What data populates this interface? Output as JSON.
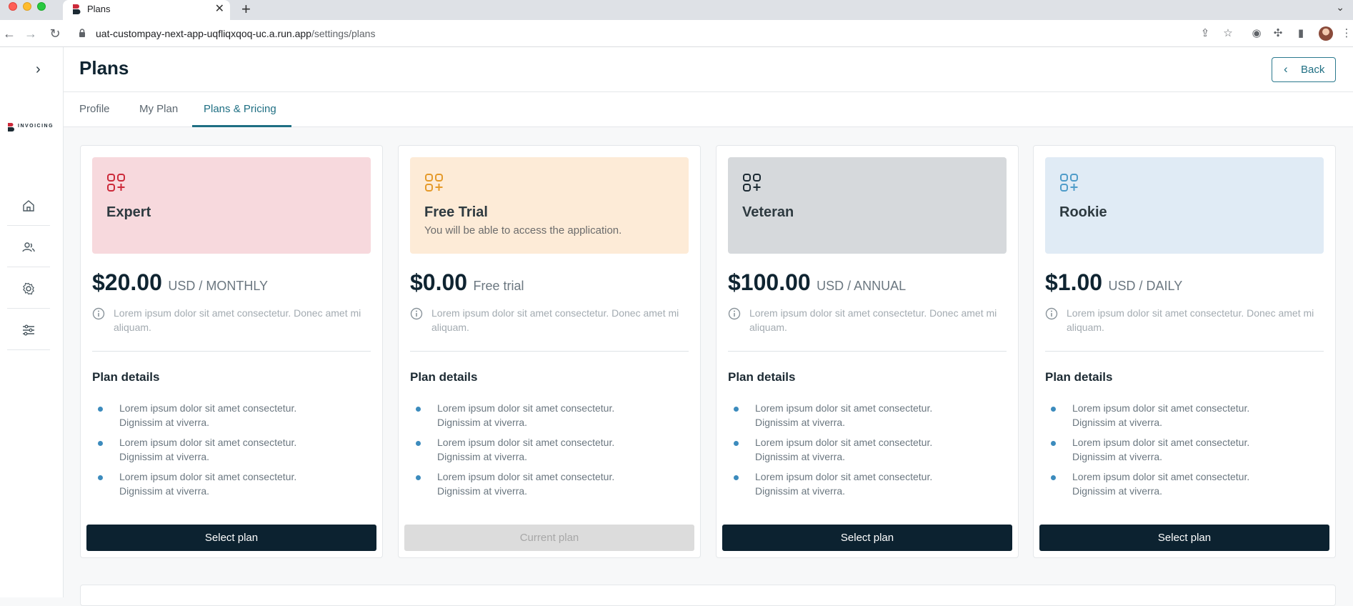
{
  "browser": {
    "tab_title": "Plans",
    "new_tab": "+",
    "close": "✕",
    "tab_menu": "⌄",
    "url_host": "uat-custompay-next-app-uqfliqxqoq-uc.a.run.app",
    "url_path": "/settings/plans"
  },
  "sidebar": {
    "toggle": "›",
    "logo_text": "INVOICING",
    "items": [
      "home-icon",
      "users-icon",
      "gear-icon",
      "sliders-icon"
    ]
  },
  "header": {
    "title": "Plans",
    "back_label": "Back",
    "back_chevron": "‹"
  },
  "tabs": [
    {
      "label": "Profile"
    },
    {
      "label": "My Plan"
    },
    {
      "label": "Plans & Pricing",
      "active": true
    }
  ],
  "plans": [
    {
      "name": "Expert",
      "desc": "",
      "price": "$20.00",
      "period": "USD / MONTHLY",
      "accent": "#cc2a3a",
      "bg": "#f7d9dd",
      "info": "Lorem ipsum dolor sit amet consectetur. Donec amet mi aliquam.",
      "details_title": "Plan details",
      "bullets": [
        "Lorem ipsum dolor sit amet consectetur. Dignissim at viverra.",
        "Lorem ipsum dolor sit amet consectetur. Dignissim at viverra.",
        "Lorem ipsum dolor sit amet consectetur. Dignissim at viverra."
      ],
      "cta": "Select plan",
      "cta_disabled": false
    },
    {
      "name": "Free Trial",
      "desc": "You will be able to access the application.",
      "price": "$0.00",
      "period": "Free trial",
      "accent": "#e59a2a",
      "bg": "#fdebd7",
      "info": "Lorem ipsum dolor sit amet consectetur. Donec amet mi aliquam.",
      "details_title": "Plan details",
      "bullets": [
        "Lorem ipsum dolor sit amet consectetur. Dignissim at viverra.",
        "Lorem ipsum dolor sit amet consectetur. Dignissim at viverra.",
        "Lorem ipsum dolor sit amet consectetur. Dignissim at viverra."
      ],
      "cta": "Current plan",
      "cta_disabled": true
    },
    {
      "name": "Veteran",
      "desc": "",
      "price": "$100.00",
      "period": "USD / ANNUAL",
      "accent": "#1c2a33",
      "bg": "#d6d9dc",
      "info": "Lorem ipsum dolor sit amet consectetur. Donec amet mi aliquam.",
      "details_title": "Plan details",
      "bullets": [
        "Lorem ipsum dolor sit amet consectetur. Dignissim at viverra.",
        "Lorem ipsum dolor sit amet consectetur. Dignissim at viverra.",
        "Lorem ipsum dolor sit amet consectetur. Dignissim at viverra."
      ],
      "cta": "Select plan",
      "cta_disabled": false
    },
    {
      "name": "Rookie",
      "desc": "",
      "price": "$1.00",
      "period": "USD / DAILY",
      "accent": "#4f9cc9",
      "bg": "#e0ebf5",
      "info": "Lorem ipsum dolor sit amet consectetur. Donec amet mi aliquam.",
      "details_title": "Plan details",
      "bullets": [
        "Lorem ipsum dolor sit amet consectetur. Dignissim at viverra.",
        "Lorem ipsum dolor sit amet consectetur. Dignissim at viverra.",
        "Lorem ipsum dolor sit amet consectetur. Dignissim at viverra."
      ],
      "cta": "Select plan",
      "cta_disabled": false
    }
  ]
}
